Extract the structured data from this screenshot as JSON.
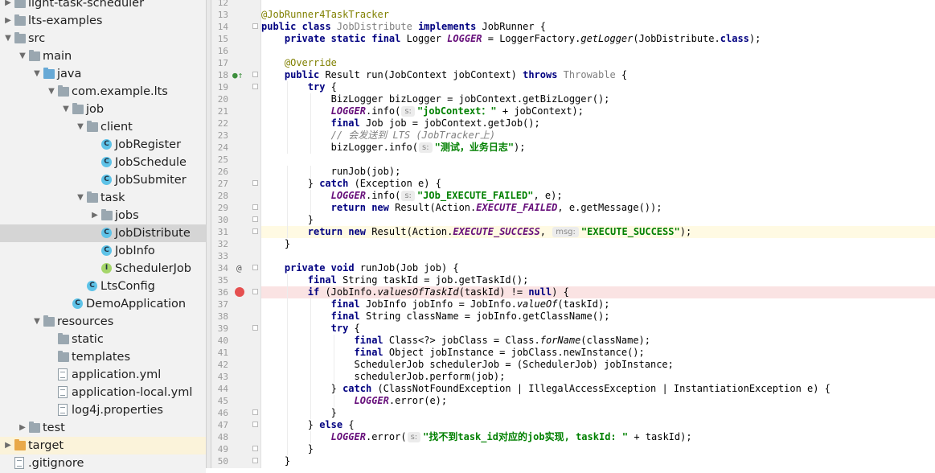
{
  "project_tree": {
    "items": [
      {
        "label": "light-task-scheduler",
        "arrow": "▶",
        "icon": "folder-icon",
        "depth": 0
      },
      {
        "label": "lts-examples",
        "arrow": "▶",
        "icon": "folder-icon",
        "depth": 0
      },
      {
        "label": "src",
        "arrow": "▼",
        "icon": "folder-icon",
        "depth": 0
      },
      {
        "label": "main",
        "arrow": "▼",
        "icon": "folder-icon",
        "depth": 1
      },
      {
        "label": "java",
        "arrow": "▼",
        "icon": "source-folder-icon",
        "depth": 2
      },
      {
        "label": "com.example.lts",
        "arrow": "▼",
        "icon": "package-icon",
        "depth": 3
      },
      {
        "label": "job",
        "arrow": "▼",
        "icon": "package-icon",
        "depth": 4
      },
      {
        "label": "client",
        "arrow": "▼",
        "icon": "package-icon",
        "depth": 5
      },
      {
        "label": "JobRegister",
        "arrow": "",
        "icon": "class-icon",
        "depth": 6
      },
      {
        "label": "JobSchedule",
        "arrow": "",
        "icon": "class-icon",
        "depth": 6
      },
      {
        "label": "JobSubmiter",
        "arrow": "",
        "icon": "class-icon",
        "depth": 6
      },
      {
        "label": "task",
        "arrow": "▼",
        "icon": "package-icon",
        "depth": 5
      },
      {
        "label": "jobs",
        "arrow": "▶",
        "icon": "package-icon",
        "depth": 6
      },
      {
        "label": "JobDistribute",
        "arrow": "",
        "icon": "class-icon",
        "depth": 6,
        "selected": true
      },
      {
        "label": "JobInfo",
        "arrow": "",
        "icon": "class-icon",
        "depth": 6
      },
      {
        "label": "SchedulerJob",
        "arrow": "",
        "icon": "interface-icon",
        "depth": 6
      },
      {
        "label": "LtsConfig",
        "arrow": "",
        "icon": "class-icon",
        "depth": 5
      },
      {
        "label": "DemoApplication",
        "arrow": "",
        "icon": "spring-class-icon",
        "depth": 4
      },
      {
        "label": "resources",
        "arrow": "▼",
        "icon": "resources-folder-icon",
        "depth": 2
      },
      {
        "label": "static",
        "arrow": "",
        "icon": "folder-icon",
        "depth": 3
      },
      {
        "label": "templates",
        "arrow": "",
        "icon": "folder-icon",
        "depth": 3
      },
      {
        "label": "application.yml",
        "arrow": "",
        "icon": "yml-file-icon",
        "depth": 3
      },
      {
        "label": "application-local.yml",
        "arrow": "",
        "icon": "yml-file-icon",
        "depth": 3
      },
      {
        "label": "log4j.properties",
        "arrow": "",
        "icon": "properties-file-icon",
        "depth": 3
      },
      {
        "label": "test",
        "arrow": "▶",
        "icon": "folder-icon",
        "depth": 1
      },
      {
        "label": "target",
        "arrow": "▶",
        "icon": "excluded-folder-icon",
        "depth": 0,
        "highlighted": true
      },
      {
        "label": ".gitignore",
        "arrow": "",
        "icon": "text-file-icon",
        "depth": 0
      }
    ]
  },
  "editor": {
    "gutter_markers": {
      "18": "implements-method-icon",
      "34": "annotation-marker-icon",
      "36": "breakpoint-icon"
    },
    "caret_line": 31,
    "breakpoint_line": 36,
    "lines": [
      {
        "n": "12",
        "indent": 0,
        "tokens": []
      },
      {
        "n": "13",
        "indent": 0,
        "tokens": [
          {
            "c": "ann",
            "t": "@JobRunner4TaskTracker"
          }
        ]
      },
      {
        "n": "14",
        "indent": 0,
        "tokens": [
          {
            "c": "kw",
            "t": "public class "
          },
          {
            "c": "unused",
            "t": "JobDistribute"
          },
          {
            "c": "kw",
            "t": " implements "
          },
          {
            "c": "",
            "t": "JobRunner {"
          }
        ]
      },
      {
        "n": "15",
        "indent": 1,
        "tokens": [
          {
            "c": "kw",
            "t": "private static final "
          },
          {
            "c": "",
            "t": "Logger "
          },
          {
            "c": "fld",
            "t": "LOGGER"
          },
          {
            "c": "",
            "t": " = LoggerFactory."
          },
          {
            "c": "smeth",
            "t": "getLogger"
          },
          {
            "c": "",
            "t": "(JobDistribute."
          },
          {
            "c": "kw",
            "t": "class"
          },
          {
            "c": "",
            "t": ");"
          }
        ]
      },
      {
        "n": "16",
        "indent": 0,
        "tokens": []
      },
      {
        "n": "17",
        "indent": 1,
        "tokens": [
          {
            "c": "ann",
            "t": "@Override"
          }
        ]
      },
      {
        "n": "18",
        "indent": 1,
        "tokens": [
          {
            "c": "kw",
            "t": "public "
          },
          {
            "c": "",
            "t": "Result run(JobContext jobContext) "
          },
          {
            "c": "kw",
            "t": "throws "
          },
          {
            "c": "unused",
            "t": "Throwable"
          },
          {
            "c": "",
            "t": " {"
          }
        ]
      },
      {
        "n": "19",
        "indent": 2,
        "tokens": [
          {
            "c": "kw",
            "t": "try "
          },
          {
            "c": "",
            "t": "{"
          }
        ]
      },
      {
        "n": "20",
        "indent": 3,
        "tokens": [
          {
            "c": "",
            "t": "BizLogger bizLogger = jobContext.getBizLogger();"
          }
        ]
      },
      {
        "n": "21",
        "indent": 3,
        "tokens": [
          {
            "c": "fld",
            "t": "LOGGER"
          },
          {
            "c": "",
            "t": ".info("
          },
          {
            "c": "hint",
            "t": "s:"
          },
          {
            "c": "str",
            "t": "\"jobContext：\""
          },
          {
            "c": "",
            "t": " + jobContext);"
          }
        ]
      },
      {
        "n": "22",
        "indent": 3,
        "tokens": [
          {
            "c": "kw",
            "t": "final "
          },
          {
            "c": "",
            "t": "Job job = jobContext.getJob();"
          }
        ]
      },
      {
        "n": "23",
        "indent": 3,
        "tokens": [
          {
            "c": "cmt",
            "t": "// 会发送到 LTS (JobTracker上)"
          }
        ]
      },
      {
        "n": "24",
        "indent": 3,
        "tokens": [
          {
            "c": "",
            "t": "bizLogger.info("
          },
          {
            "c": "hint",
            "t": "s:"
          },
          {
            "c": "str",
            "t": "\"测试，业务日志\""
          },
          {
            "c": "",
            "t": ");"
          }
        ]
      },
      {
        "n": "25",
        "indent": 0,
        "tokens": []
      },
      {
        "n": "26",
        "indent": 3,
        "tokens": [
          {
            "c": "",
            "t": "runJob(job);"
          }
        ]
      },
      {
        "n": "27",
        "indent": 2,
        "tokens": [
          {
            "c": "",
            "t": "} "
          },
          {
            "c": "kw",
            "t": "catch "
          },
          {
            "c": "",
            "t": "(Exception e) {"
          }
        ]
      },
      {
        "n": "28",
        "indent": 3,
        "tokens": [
          {
            "c": "fld",
            "t": "LOGGER"
          },
          {
            "c": "",
            "t": ".info("
          },
          {
            "c": "hint",
            "t": "s:"
          },
          {
            "c": "str",
            "t": "\"JOb_EXECUTE_FAILED\""
          },
          {
            "c": "",
            "t": ", e);"
          }
        ]
      },
      {
        "n": "29",
        "indent": 3,
        "tokens": [
          {
            "c": "kw",
            "t": "return new "
          },
          {
            "c": "",
            "t": "Result(Action."
          },
          {
            "c": "fld",
            "t": "EXECUTE_FAILED"
          },
          {
            "c": "",
            "t": ", e.getMessage());"
          }
        ]
      },
      {
        "n": "30",
        "indent": 2,
        "tokens": [
          {
            "c": "",
            "t": "}"
          }
        ]
      },
      {
        "n": "31",
        "indent": 2,
        "tokens": [
          {
            "c": "kw",
            "t": "return new "
          },
          {
            "c": "",
            "t": "Result(Action."
          },
          {
            "c": "fld",
            "t": "EXECUTE_SUCCESS"
          },
          {
            "c": "",
            "t": ", "
          },
          {
            "c": "hint",
            "t": "msg:"
          },
          {
            "c": "str",
            "t": "\"EXECUTE_SUCCESS\""
          },
          {
            "c": "",
            "t": ");"
          }
        ]
      },
      {
        "n": "32",
        "indent": 1,
        "tokens": [
          {
            "c": "",
            "t": "}"
          }
        ]
      },
      {
        "n": "33",
        "indent": 0,
        "tokens": []
      },
      {
        "n": "34",
        "indent": 1,
        "tokens": [
          {
            "c": "kw",
            "t": "private void "
          },
          {
            "c": "",
            "t": "runJob(Job job) {"
          }
        ]
      },
      {
        "n": "35",
        "indent": 2,
        "tokens": [
          {
            "c": "kw",
            "t": "final "
          },
          {
            "c": "",
            "t": "String taskId = job.getTaskId();"
          }
        ]
      },
      {
        "n": "36",
        "indent": 2,
        "tokens": [
          {
            "c": "kw",
            "t": "if "
          },
          {
            "c": "",
            "t": "(JobInfo."
          },
          {
            "c": "smeth",
            "t": "valuesOfTaskId"
          },
          {
            "c": "",
            "t": "(taskId) != "
          },
          {
            "c": "kw",
            "t": "null"
          },
          {
            "c": "",
            "t": ") {"
          }
        ]
      },
      {
        "n": "37",
        "indent": 3,
        "tokens": [
          {
            "c": "kw",
            "t": "final "
          },
          {
            "c": "",
            "t": "JobInfo jobInfo = JobInfo."
          },
          {
            "c": "smeth",
            "t": "valueOf"
          },
          {
            "c": "",
            "t": "(taskId);"
          }
        ]
      },
      {
        "n": "38",
        "indent": 3,
        "tokens": [
          {
            "c": "kw",
            "t": "final "
          },
          {
            "c": "",
            "t": "String className = jobInfo.getClassName();"
          }
        ]
      },
      {
        "n": "39",
        "indent": 3,
        "tokens": [
          {
            "c": "kw",
            "t": "try "
          },
          {
            "c": "",
            "t": "{"
          }
        ]
      },
      {
        "n": "40",
        "indent": 4,
        "tokens": [
          {
            "c": "kw",
            "t": "final "
          },
          {
            "c": "",
            "t": "Class<?> jobClass = Class."
          },
          {
            "c": "smeth",
            "t": "forName"
          },
          {
            "c": "",
            "t": "(className);"
          }
        ]
      },
      {
        "n": "41",
        "indent": 4,
        "tokens": [
          {
            "c": "kw",
            "t": "final "
          },
          {
            "c": "",
            "t": "Object jobInstance = jobClass.newInstance();"
          }
        ]
      },
      {
        "n": "42",
        "indent": 4,
        "tokens": [
          {
            "c": "",
            "t": "SchedulerJob schedulerJob = (SchedulerJob) jobInstance;"
          }
        ]
      },
      {
        "n": "43",
        "indent": 4,
        "tokens": [
          {
            "c": "",
            "t": "schedulerJob.perform(job);"
          }
        ]
      },
      {
        "n": "44",
        "indent": 3,
        "tokens": [
          {
            "c": "",
            "t": "} "
          },
          {
            "c": "kw",
            "t": "catch "
          },
          {
            "c": "",
            "t": "(ClassNotFoundException | IllegalAccessException | InstantiationException e) {"
          }
        ]
      },
      {
        "n": "45",
        "indent": 4,
        "tokens": [
          {
            "c": "fld",
            "t": "LOGGER"
          },
          {
            "c": "",
            "t": ".error(e);"
          }
        ]
      },
      {
        "n": "46",
        "indent": 3,
        "tokens": [
          {
            "c": "",
            "t": "}"
          }
        ]
      },
      {
        "n": "47",
        "indent": 2,
        "tokens": [
          {
            "c": "",
            "t": "} "
          },
          {
            "c": "kw",
            "t": "else "
          },
          {
            "c": "",
            "t": "{"
          }
        ]
      },
      {
        "n": "48",
        "indent": 3,
        "tokens": [
          {
            "c": "fld",
            "t": "LOGGER"
          },
          {
            "c": "",
            "t": ".error("
          },
          {
            "c": "hint",
            "t": "s:"
          },
          {
            "c": "str",
            "t": "\"找不到task_id对应的job实现, taskId: \""
          },
          {
            "c": "",
            "t": " + taskId);"
          }
        ]
      },
      {
        "n": "49",
        "indent": 2,
        "tokens": [
          {
            "c": "",
            "t": "}"
          }
        ]
      },
      {
        "n": "50",
        "indent": 1,
        "tokens": [
          {
            "c": "",
            "t": "}"
          }
        ]
      }
    ],
    "fold_lines": [
      "14",
      "18",
      "19",
      "27",
      "29",
      "30",
      "31",
      "34",
      "36",
      "39",
      "46",
      "47",
      "49",
      "50"
    ]
  },
  "colors": {
    "keyword": "#000080",
    "string": "#008000",
    "annotation": "#808000",
    "static_field": "#660e7a",
    "comment": "#808080",
    "caret_row": "#fffae3",
    "breakpoint_row": "#fae3e3",
    "selection": "#d5d5d5"
  }
}
